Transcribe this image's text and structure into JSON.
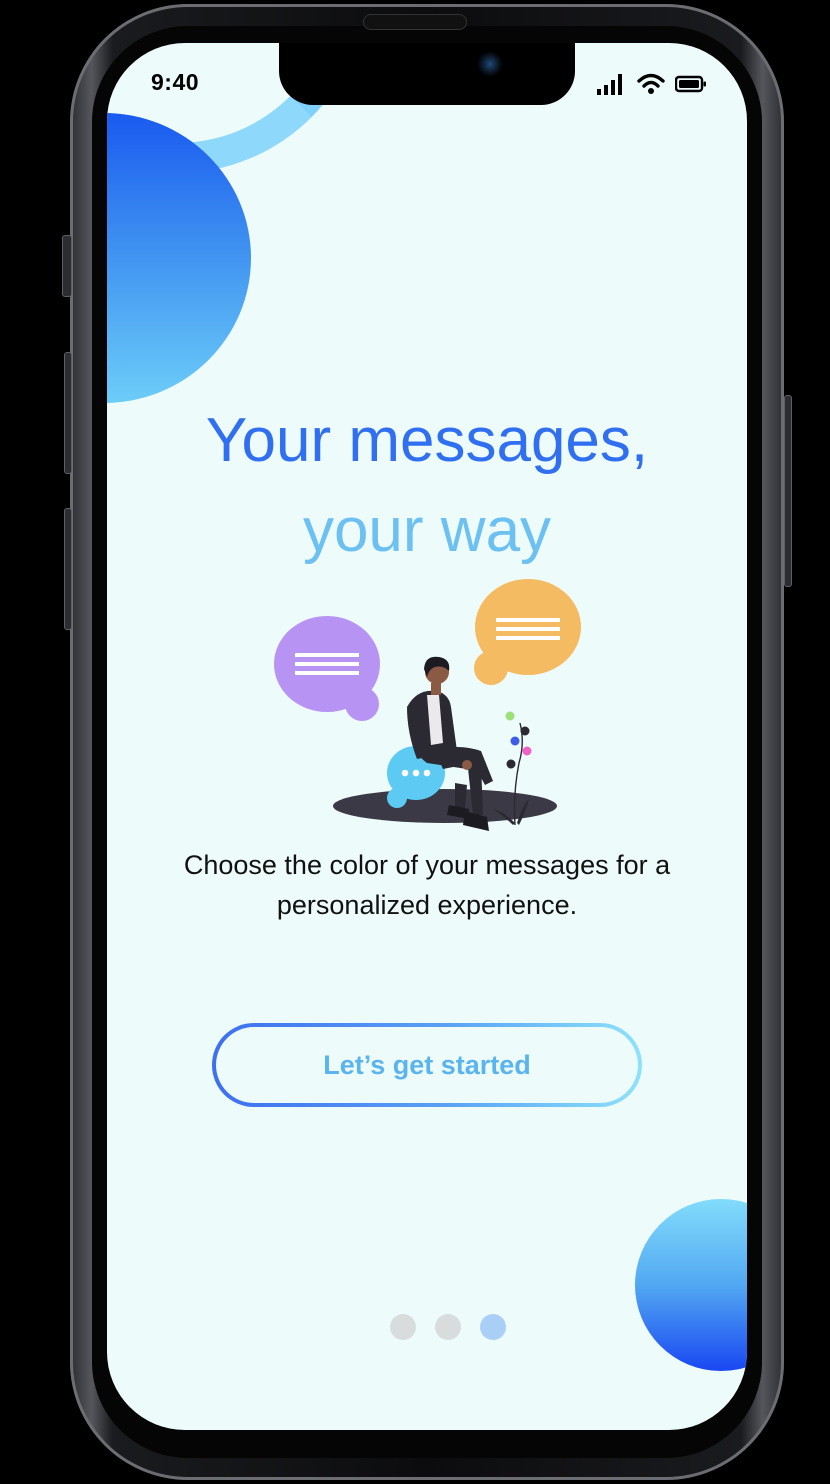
{
  "status_bar": {
    "time": "9:40",
    "icons": [
      "cellular-signal-icon",
      "wifi-icon",
      "battery-icon"
    ]
  },
  "onboarding": {
    "headline_line1": "Your messages,",
    "headline_line2": "your way",
    "description": "Choose the color of your messages for a personalized experience.",
    "cta_label": "Let’s get started",
    "pagination": {
      "total": 3,
      "active_index": 2
    }
  },
  "colors": {
    "background": "#eefbfb",
    "primary_blue": "#2f6ff0",
    "light_blue": "#6cc0f2",
    "bubble_purple": "#b794f4",
    "bubble_orange": "#f5bb62",
    "bubble_cyan": "#5ccaf2"
  }
}
